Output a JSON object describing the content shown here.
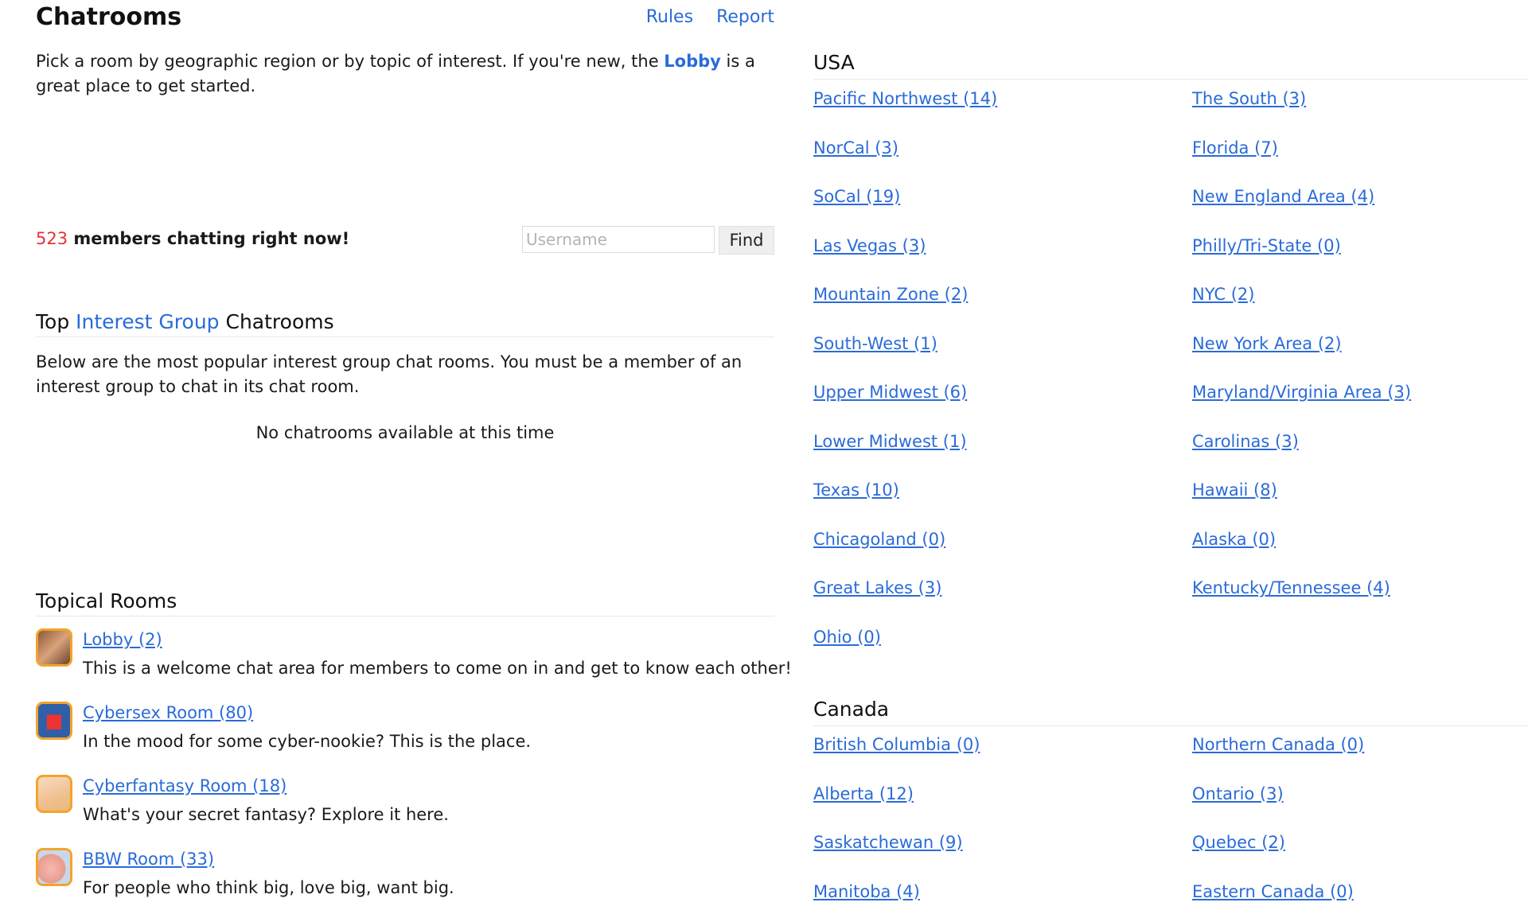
{
  "header": {
    "title": "Chatrooms",
    "rules_label": "Rules",
    "report_label": "Report"
  },
  "intro": {
    "text_before": "Pick a room by geographic region or by topic of interest. If you're new, the ",
    "lobby_link": "Lobby",
    "text_after": " is a great place to get started."
  },
  "members": {
    "count": "523",
    "text": " members chatting right now!"
  },
  "find": {
    "placeholder": "Username",
    "button_label": "Find"
  },
  "interest_groups": {
    "heading_prefix": "Top ",
    "heading_link": "Interest Group",
    "heading_suffix": " Chatrooms",
    "description": "Below are the most popular interest group chat rooms. You must be a member of an interest group to chat in its chat room.",
    "empty_message": "No chatrooms available at this time"
  },
  "topical": {
    "heading": "Topical Rooms",
    "rooms": [
      {
        "label": "Lobby (2)",
        "description": "This is a welcome chat area for members to come on in and get to know each other!",
        "icon": "lobby-icon"
      },
      {
        "label": "Cybersex Room (80)",
        "description": "In the mood for some cyber-nookie? This is the place.",
        "icon": "cybersex-room-icon"
      },
      {
        "label": "Cyberfantasy Room (18)",
        "description": "What's your secret fantasy? Explore it here.",
        "icon": "cyberfantasy-room-icon"
      },
      {
        "label": "BBW Room (33)",
        "description": "For people who think big, love big, want big.",
        "icon": "bbw-room-icon"
      }
    ]
  },
  "usa": {
    "heading": "USA",
    "rooms": [
      "Pacific Northwest (14)",
      "The South (3)",
      "NorCal (3)",
      "Florida (7)",
      "SoCal (19)",
      "New England Area (4)",
      "Las Vegas (3)",
      "Philly/Tri-State (0)",
      "Mountain Zone (2)",
      "NYC (2)",
      "South-West (1)",
      "New York Area (2)",
      "Upper Midwest (6)",
      "Maryland/Virginia Area (3)",
      "Lower Midwest (1)",
      "Carolinas (3)",
      "Texas (10)",
      "Hawaii (8)",
      "Chicagoland (0)",
      "Alaska (0)",
      "Great Lakes (3)",
      "Kentucky/Tennessee (4)",
      "Ohio (0)"
    ]
  },
  "canada": {
    "heading": "Canada",
    "rooms": [
      "British Columbia (0)",
      "Northern Canada (0)",
      "Alberta (12)",
      "Ontario (3)",
      "Saskatchewan (9)",
      "Quebec (2)",
      "Manitoba (4)",
      "Eastern Canada (0)"
    ]
  }
}
